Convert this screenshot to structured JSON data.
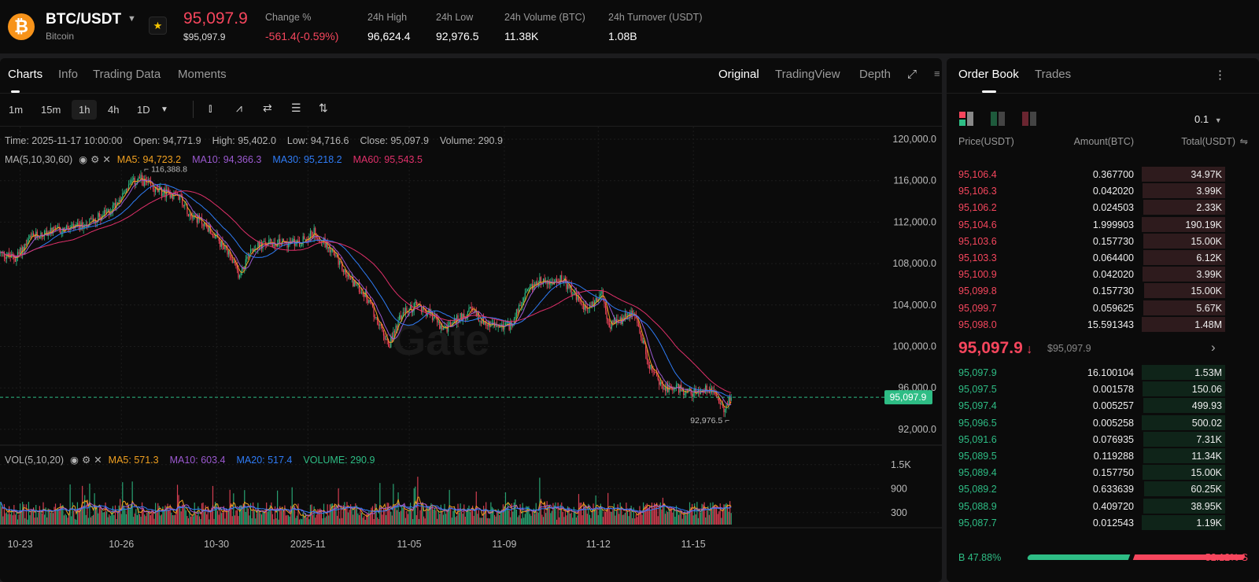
{
  "header": {
    "coin_icon": "bitcoin-icon",
    "pair": "BTC/USDT",
    "name": "Bitcoin",
    "last_price": "95,097.9",
    "last_price_usd": "$95,097.9",
    "stats": [
      {
        "label": "Change %",
        "value": "-561.4(-0.59%)",
        "color": "#f6465d"
      },
      {
        "label": "24h High",
        "value": "96,624.4"
      },
      {
        "label": "24h Low",
        "value": "92,976.5"
      },
      {
        "label": "24h Volume (BTC)",
        "value": "11.38K"
      },
      {
        "label": "24h Turnover (USDT)",
        "value": "1.08B"
      }
    ]
  },
  "chart_tabs": [
    "Charts",
    "Info",
    "Trading Data",
    "Moments"
  ],
  "view_tabs": [
    "Original",
    "TradingView",
    "Depth"
  ],
  "timeframes": [
    "1m",
    "15m",
    "1h",
    "4h",
    "1D"
  ],
  "active_timeframe": "1h",
  "ohlc_info": {
    "time": "Time: 2025-11-17 10:00:00",
    "open": "Open: 94,771.9",
    "high": "High: 95,402.0",
    "low": "Low: 94,716.6",
    "close": "Close: 95,097.9",
    "volume": "Volume: 290.9"
  },
  "ma_info": {
    "label": "MA(5,10,30,60)",
    "ma5": "MA5: 94,723.2",
    "ma10": "MA10: 94,366.3",
    "ma30": "MA30: 95,218.2",
    "ma60": "MA60: 95,543.5"
  },
  "vol_info": {
    "label": "VOL(5,10,20)",
    "ma5": "MA5: 571.3",
    "ma10": "MA10: 603.4",
    "ma20": "MA20: 517.4",
    "volume": "VOLUME: 290.9"
  },
  "watermark": "Gate",
  "colors": {
    "up": "#2ebd85",
    "down": "#f6465d",
    "ma5": "#f0a020",
    "ma10": "#9b59d0",
    "ma30": "#2f7cf6",
    "ma60": "#e0306a"
  },
  "chart_data": {
    "type": "candlestick",
    "ylim": [
      90000,
      121000
    ],
    "y_ticks": [
      "120,000.0",
      "116,000.0",
      "112,000.0",
      "108,000.0",
      "104,000.0",
      "100,000.0",
      "96,000.0",
      "92,000.0"
    ],
    "y_tick_values": [
      120000,
      116000,
      112000,
      108000,
      104000,
      100000,
      96000,
      92000
    ],
    "vol_ticks": [
      "1.5K",
      "900",
      "300"
    ],
    "vol_tick_values": [
      1500,
      900,
      300
    ],
    "x_ticks": [
      {
        "label": "10-23",
        "hour": 16
      },
      {
        "label": "10-26",
        "hour": 99
      },
      {
        "label": "10-30",
        "hour": 177
      },
      {
        "label": "2025-11",
        "hour": 252
      },
      {
        "label": "11-05",
        "hour": 335
      },
      {
        "label": "11-09",
        "hour": 413
      },
      {
        "label": "11-12",
        "hour": 490
      },
      {
        "label": "11-15",
        "hour": 568
      }
    ],
    "max_label": "116,388.8",
    "min_label": "92,976.5",
    "current_price": "95,097.9",
    "current_value": 95097.9,
    "last_candle": {
      "open": 94771.9,
      "high": 95402.0,
      "low": 94716.6,
      "close": 95097.9,
      "volume": 290.9
    },
    "price_path": [
      [
        0,
        109000
      ],
      [
        13,
        108500
      ],
      [
        26,
        110500
      ],
      [
        39,
        111000
      ],
      [
        65,
        111500
      ],
      [
        90,
        113000
      ],
      [
        106,
        115500
      ],
      [
        115,
        116200
      ],
      [
        129,
        115000
      ],
      [
        148,
        114500
      ],
      [
        155,
        113000
      ],
      [
        171,
        111500
      ],
      [
        187,
        109000
      ],
      [
        197,
        106800
      ],
      [
        206,
        109500
      ],
      [
        223,
        110000
      ],
      [
        245,
        110000
      ],
      [
        258,
        111000
      ],
      [
        271,
        109500
      ],
      [
        284,
        107000
      ],
      [
        300,
        105000
      ],
      [
        310,
        102500
      ],
      [
        319,
        100000
      ],
      [
        329,
        103000
      ],
      [
        342,
        104000
      ],
      [
        355,
        103000
      ],
      [
        364,
        101500
      ],
      [
        374,
        102500
      ],
      [
        387,
        103500
      ],
      [
        400,
        102000
      ],
      [
        419,
        102000
      ],
      [
        432,
        105000
      ],
      [
        442,
        106500
      ],
      [
        452,
        106000
      ],
      [
        461,
        106500
      ],
      [
        471,
        105000
      ],
      [
        481,
        103500
      ],
      [
        494,
        105000
      ],
      [
        500,
        102000
      ],
      [
        510,
        102500
      ],
      [
        519,
        103500
      ],
      [
        526,
        101000
      ],
      [
        535,
        97500
      ],
      [
        545,
        96000
      ],
      [
        555,
        96000
      ],
      [
        568,
        95500
      ],
      [
        584,
        96000
      ],
      [
        594,
        94000
      ],
      [
        600,
        95097.9
      ]
    ]
  },
  "order_book": {
    "tabs": [
      "Order Book",
      "Trades"
    ],
    "precision": "0.1",
    "headers": [
      "Price(USDT)",
      "Amount(BTC)",
      "Total(USDT)"
    ],
    "asks": [
      [
        "95,106.4",
        "0.367700",
        "34.97K"
      ],
      [
        "95,106.3",
        "0.042020",
        "3.99K"
      ],
      [
        "95,106.2",
        "0.024503",
        "2.33K"
      ],
      [
        "95,104.6",
        "1.999903",
        "190.19K"
      ],
      [
        "95,103.6",
        "0.157730",
        "15.00K"
      ],
      [
        "95,103.3",
        "0.064400",
        "6.12K"
      ],
      [
        "95,100.9",
        "0.042020",
        "3.99K"
      ],
      [
        "95,099.8",
        "0.157730",
        "15.00K"
      ],
      [
        "95,099.7",
        "0.059625",
        "5.67K"
      ],
      [
        "95,098.0",
        "15.591343",
        "1.48M"
      ]
    ],
    "mid_price": "95,097.9",
    "mid_usd": "$95,097.9",
    "bids": [
      [
        "95,097.9",
        "16.100104",
        "1.53M"
      ],
      [
        "95,097.5",
        "0.001578",
        "150.06"
      ],
      [
        "95,097.4",
        "0.005257",
        "499.93"
      ],
      [
        "95,096.5",
        "0.005258",
        "500.02"
      ],
      [
        "95,091.6",
        "0.076935",
        "7.31K"
      ],
      [
        "95,089.5",
        "0.119288",
        "11.34K"
      ],
      [
        "95,089.4",
        "0.157750",
        "15.00K"
      ],
      [
        "95,089.2",
        "0.633639",
        "60.25K"
      ],
      [
        "95,088.9",
        "0.409720",
        "38.95K"
      ],
      [
        "95,087.7",
        "0.012543",
        "1.19K"
      ]
    ],
    "buy_label": "B 47.88%",
    "sell_label": "52.12% S",
    "buy_pct": 47.88
  }
}
